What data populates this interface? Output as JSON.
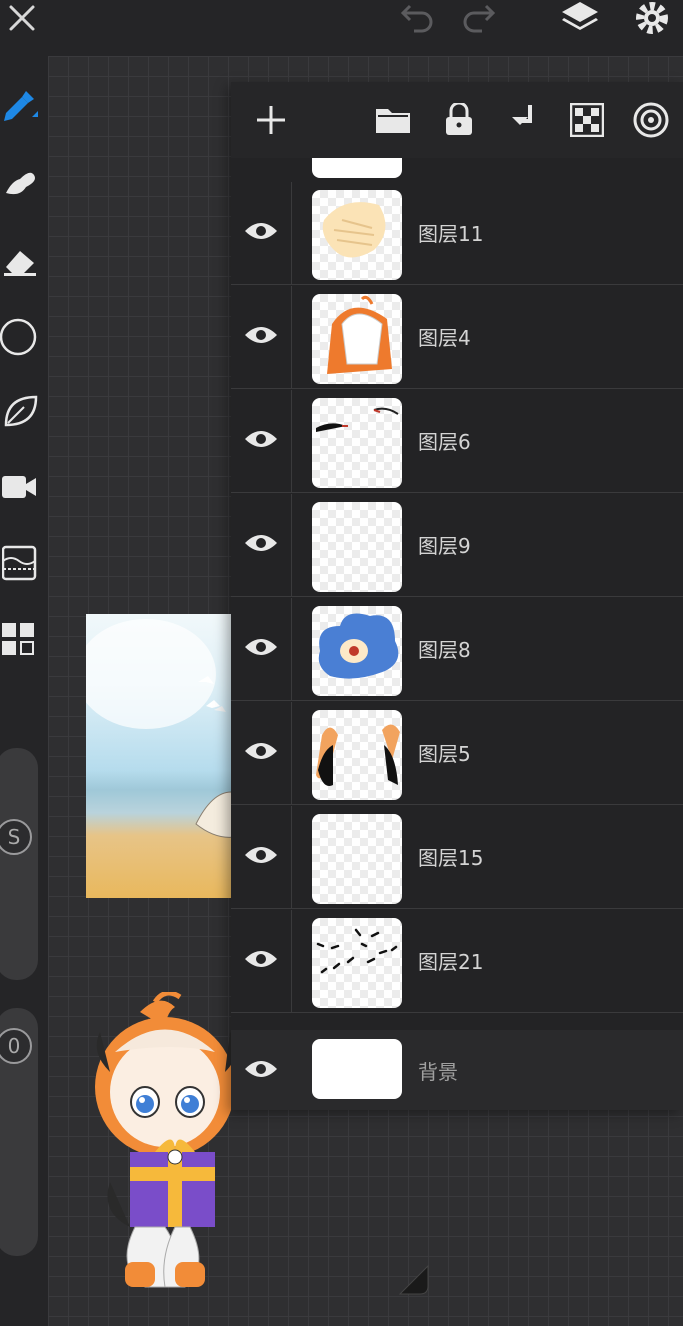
{
  "topbar": {
    "close_icon": "close-icon",
    "undo_icon": "undo-icon",
    "redo_icon": "redo-icon",
    "layers_icon": "layers-icon",
    "settings_icon": "gear-icon"
  },
  "sidebar": {
    "tools": [
      "pen-icon",
      "smudge-icon",
      "eraser-icon",
      "circle-icon",
      "leaf-icon",
      "camera-icon",
      "filter-icon",
      "grid-icon"
    ],
    "size_label": "S",
    "opacity_label": "0"
  },
  "layer_toolbar": {
    "icons": [
      "add-icon",
      "folder-icon",
      "lock-icon",
      "merge-down-icon",
      "checker-icon",
      "target-icon"
    ]
  },
  "layers": [
    {
      "name": "图层11"
    },
    {
      "name": "图层4"
    },
    {
      "name": "图层6"
    },
    {
      "name": "图层9"
    },
    {
      "name": "图层8"
    },
    {
      "name": "图层5"
    },
    {
      "name": "图层15"
    },
    {
      "name": "图层21"
    }
  ],
  "background_layer": {
    "name": "背景"
  },
  "colors": {
    "accent": "#1e88e5",
    "panel": "#232325",
    "toolbar": "#252527"
  }
}
